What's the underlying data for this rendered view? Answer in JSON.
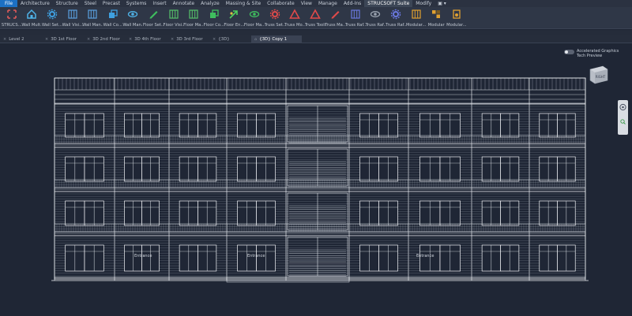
{
  "menu": [
    "File",
    "Architecture",
    "Structure",
    "Steel",
    "Precast",
    "Systems",
    "Insert",
    "Annotate",
    "Analyze",
    "Massing & Site",
    "Collaborate",
    "View",
    "Manage",
    "Add-Ins",
    "STRUCSOFT Suite",
    "Modify",
    "▣ ▾"
  ],
  "ribbon": [
    {
      "label": "STRUCS...",
      "icon": "brackets",
      "color": "#e05a5a"
    },
    {
      "label": "Wall Mult...",
      "icon": "house",
      "color": "#4fb3e8"
    },
    {
      "label": "Wall Set...",
      "icon": "gear",
      "color": "#3fa0e0"
    },
    {
      "label": "Wall Visi...",
      "icon": "grid",
      "color": "#5aa0e0"
    },
    {
      "label": "Wall Man...",
      "icon": "grid",
      "color": "#5aa0e0"
    },
    {
      "label": "Wall Co...",
      "icon": "stack",
      "color": "#3fa0e0"
    },
    {
      "label": "Wall Man...",
      "icon": "eye",
      "color": "#4fb3e8"
    },
    {
      "label": "Floor Set...",
      "icon": "pencil",
      "color": "#3fbf5f"
    },
    {
      "label": "Floor Visi...",
      "icon": "grid",
      "color": "#56c26a"
    },
    {
      "label": "Floor Ma...",
      "icon": "grid",
      "color": "#56c26a"
    },
    {
      "label": "Floor Co...",
      "icon": "stack",
      "color": "#3fbf5f"
    },
    {
      "label": "Floor En...",
      "icon": "arrow",
      "color": "#4fcf5f"
    },
    {
      "label": "Floor Ma...",
      "icon": "eye",
      "color": "#3fbf5f"
    },
    {
      "label": "Truss Set...",
      "icon": "gear",
      "color": "#e04a4a"
    },
    {
      "label": "Truss Mo...",
      "icon": "triangle",
      "color": "#e04a4a"
    },
    {
      "label": "Truss Tools",
      "icon": "triangle",
      "color": "#e04a4a"
    },
    {
      "label": "Truss Ma...",
      "icon": "pencil",
      "color": "#e04a4a"
    },
    {
      "label": "Truss Raf...",
      "icon": "grid",
      "color": "#6a78e0"
    },
    {
      "label": "Truss Raf...",
      "icon": "eye",
      "color": "#9aa3b0"
    },
    {
      "label": "Truss Raf...",
      "icon": "gear",
      "color": "#6a78e0"
    },
    {
      "label": "Modular...",
      "icon": "grid",
      "color": "#e0a030"
    },
    {
      "label": "Modular",
      "icon": "cubes",
      "color": "#e0a030"
    },
    {
      "label": "Modular...",
      "icon": "doc",
      "color": "#e0a030"
    }
  ],
  "tabs": [
    {
      "label": "Level 2",
      "active": false
    },
    {
      "label": "3D 1st Floor",
      "active": false
    },
    {
      "label": "3D 2nd Floor",
      "active": false
    },
    {
      "label": "3D 4th Floor",
      "active": false
    },
    {
      "label": "3D 3rd Floor",
      "active": false
    },
    {
      "label": "{3D}",
      "active": false
    },
    {
      "label": "{3D} Copy 1",
      "active": true
    }
  ],
  "viewport": {
    "preview_line1": "Accelerated Graphics",
    "preview_line2": "Tech Preview",
    "viewcube_label": "RIGHT",
    "entrance_label_left": "Entrance",
    "entrance_label_mid": "Entrance",
    "entrance_label_right": "Entrance"
  }
}
